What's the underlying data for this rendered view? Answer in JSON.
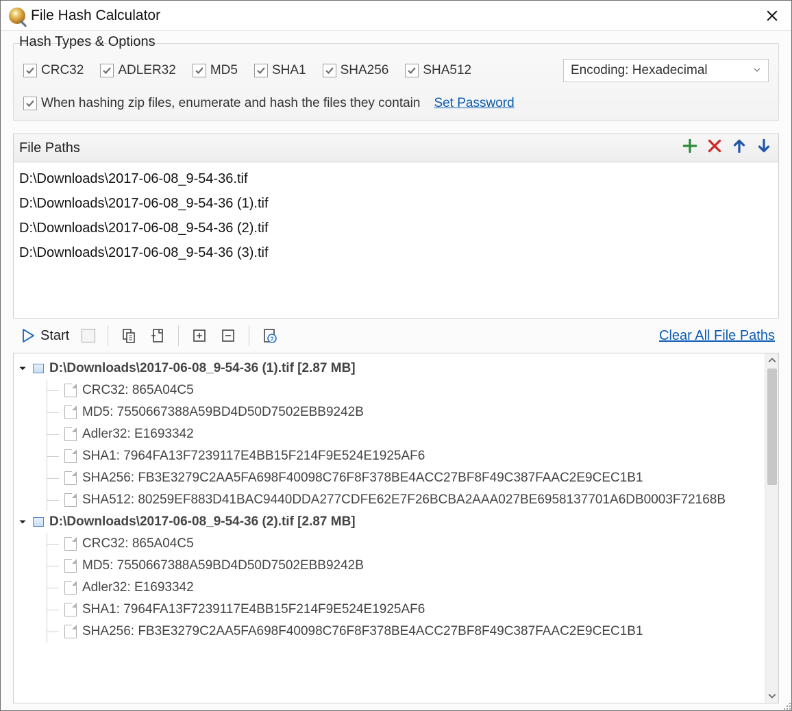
{
  "window": {
    "title": "File Hash Calculator"
  },
  "group": {
    "legend": "Hash Types & Options",
    "zip_option": "When hashing zip files, enumerate and hash the files they contain",
    "set_password": "Set Password",
    "encoding_label": "Encoding: Hexadecimal"
  },
  "hash_types": [
    "CRC32",
    "ADLER32",
    "MD5",
    "SHA1",
    "SHA256",
    "SHA512"
  ],
  "filepaths": {
    "header": "File Paths",
    "items": [
      "D:\\Downloads\\2017-06-08_9-54-36.tif",
      "D:\\Downloads\\2017-06-08_9-54-36 (1).tif",
      "D:\\Downloads\\2017-06-08_9-54-36 (2).tif",
      "D:\\Downloads\\2017-06-08_9-54-36 (3).tif"
    ]
  },
  "toolbar": {
    "start": "Start",
    "clear": "Clear All File Paths"
  },
  "results": [
    {
      "header": "D:\\Downloads\\2017-06-08_9-54-36 (1).tif [2.87 MB]",
      "lines": [
        "CRC32: 865A04C5",
        "MD5: 7550667388A59BD4D50D7502EBB9242B",
        "Adler32: E1693342",
        "SHA1: 7964FA13F7239117E4BB15F214F9E524E1925AF6",
        "SHA256: FB3E3279C2AA5FA698F40098C76F8F378BE4ACC27BF8F49C387FAAC2E9CEC1B1",
        "SHA512: 80259EF883D41BAC9440DDA277CDFE62E7F26BCBA2AAA027BE6958137701A6DB0003F72168B"
      ]
    },
    {
      "header": "D:\\Downloads\\2017-06-08_9-54-36 (2).tif [2.87 MB]",
      "lines": [
        "CRC32: 865A04C5",
        "MD5: 7550667388A59BD4D50D7502EBB9242B",
        "Adler32: E1693342",
        "SHA1: 7964FA13F7239117E4BB15F214F9E524E1925AF6",
        "SHA256: FB3E3279C2AA5FA698F40098C76F8F378BE4ACC27BF8F49C387FAAC2E9CEC1B1"
      ]
    }
  ]
}
